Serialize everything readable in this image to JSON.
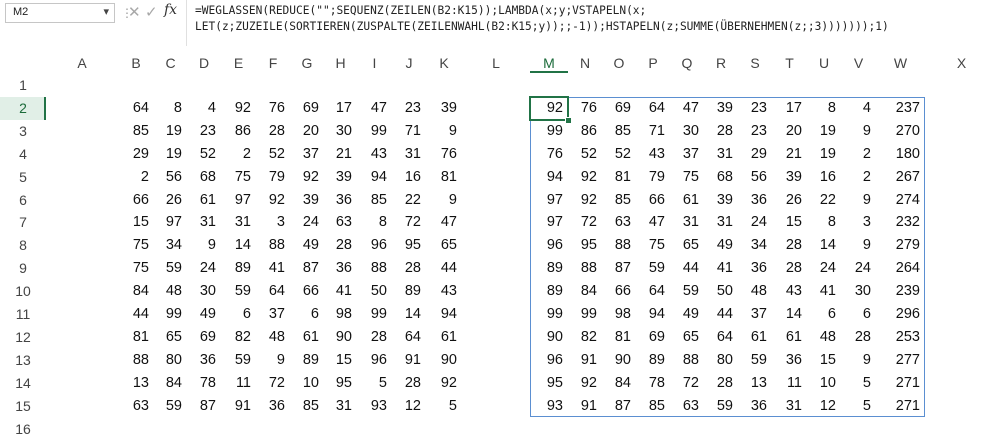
{
  "formula_bar": {
    "name_box": "M2",
    "name_box_arrow": "▾",
    "separator": "⋮",
    "cancel_icon": "✕",
    "enter_icon": "✓",
    "fx_icon": "fx",
    "formula_line1": "=WEGLASSEN(REDUCE(\"\";SEQUENZ(ZEILEN(B2:K15));LAMBDA(x;y;VSTAPELN(x;",
    "formula_line2": "LET(z;ZUZEILE(SORTIEREN(ZUSPALTE(ZEILENWAHL(B2:K15;y));;-1));HSTAPELN(z;SUMME(ÜBERNEHMEN(z;;3)))))));1)"
  },
  "grid": {
    "active_column": "M",
    "active_row": "2",
    "columns": [
      "A",
      "B",
      "C",
      "D",
      "E",
      "F",
      "G",
      "H",
      "I",
      "J",
      "K",
      "L",
      "M",
      "N",
      "O",
      "P",
      "Q",
      "R",
      "S",
      "T",
      "U",
      "V",
      "W",
      "X"
    ],
    "rows": [
      "1",
      "2",
      "3",
      "4",
      "5",
      "6",
      "7",
      "8",
      "9",
      "10",
      "11",
      "12",
      "13",
      "14",
      "15",
      "16"
    ],
    "source_block": [
      [
        "64",
        "8",
        "4",
        "92",
        "76",
        "69",
        "17",
        "47",
        "23",
        "39"
      ],
      [
        "85",
        "19",
        "23",
        "86",
        "28",
        "20",
        "30",
        "99",
        "71",
        "9"
      ],
      [
        "29",
        "19",
        "52",
        "2",
        "52",
        "37",
        "21",
        "43",
        "31",
        "76"
      ],
      [
        "2",
        "56",
        "68",
        "75",
        "79",
        "92",
        "39",
        "94",
        "16",
        "81"
      ],
      [
        "66",
        "26",
        "61",
        "97",
        "92",
        "39",
        "36",
        "85",
        "22",
        "9"
      ],
      [
        "15",
        "97",
        "31",
        "31",
        "3",
        "24",
        "63",
        "8",
        "72",
        "47"
      ],
      [
        "75",
        "34",
        "9",
        "14",
        "88",
        "49",
        "28",
        "96",
        "95",
        "65"
      ],
      [
        "75",
        "59",
        "24",
        "89",
        "41",
        "87",
        "36",
        "88",
        "28",
        "44"
      ],
      [
        "84",
        "48",
        "30",
        "59",
        "64",
        "66",
        "41",
        "50",
        "89",
        "43"
      ],
      [
        "44",
        "99",
        "49",
        "6",
        "37",
        "6",
        "98",
        "99",
        "14",
        "94"
      ],
      [
        "81",
        "65",
        "69",
        "82",
        "48",
        "61",
        "90",
        "28",
        "64",
        "61"
      ],
      [
        "88",
        "80",
        "36",
        "59",
        "9",
        "89",
        "15",
        "96",
        "91",
        "90"
      ],
      [
        "13",
        "84",
        "78",
        "11",
        "72",
        "10",
        "95",
        "5",
        "28",
        "92"
      ],
      [
        "63",
        "59",
        "87",
        "91",
        "36",
        "85",
        "31",
        "93",
        "12",
        "5"
      ]
    ],
    "result_block": [
      [
        "92",
        "76",
        "69",
        "64",
        "47",
        "39",
        "23",
        "17",
        "8",
        "4",
        "237"
      ],
      [
        "99",
        "86",
        "85",
        "71",
        "30",
        "28",
        "23",
        "20",
        "19",
        "9",
        "270"
      ],
      [
        "76",
        "52",
        "52",
        "43",
        "37",
        "31",
        "29",
        "21",
        "19",
        "2",
        "180"
      ],
      [
        "94",
        "92",
        "81",
        "79",
        "75",
        "68",
        "56",
        "39",
        "16",
        "2",
        "267"
      ],
      [
        "97",
        "92",
        "85",
        "66",
        "61",
        "39",
        "36",
        "26",
        "22",
        "9",
        "274"
      ],
      [
        "97",
        "72",
        "63",
        "47",
        "31",
        "31",
        "24",
        "15",
        "8",
        "3",
        "232"
      ],
      [
        "96",
        "95",
        "88",
        "75",
        "65",
        "49",
        "34",
        "28",
        "14",
        "9",
        "279"
      ],
      [
        "89",
        "88",
        "87",
        "59",
        "44",
        "41",
        "36",
        "28",
        "24",
        "24",
        "264"
      ],
      [
        "89",
        "84",
        "66",
        "64",
        "59",
        "50",
        "48",
        "43",
        "41",
        "30",
        "239"
      ],
      [
        "99",
        "99",
        "98",
        "94",
        "49",
        "44",
        "37",
        "14",
        "6",
        "6",
        "296"
      ],
      [
        "90",
        "82",
        "81",
        "69",
        "65",
        "64",
        "61",
        "61",
        "48",
        "28",
        "253"
      ],
      [
        "96",
        "91",
        "90",
        "89",
        "88",
        "80",
        "59",
        "36",
        "15",
        "9",
        "277"
      ],
      [
        "95",
        "92",
        "84",
        "78",
        "72",
        "28",
        "13",
        "11",
        "10",
        "5",
        "271"
      ],
      [
        "93",
        "91",
        "87",
        "85",
        "63",
        "59",
        "36",
        "31",
        "12",
        "5",
        "271"
      ]
    ]
  }
}
